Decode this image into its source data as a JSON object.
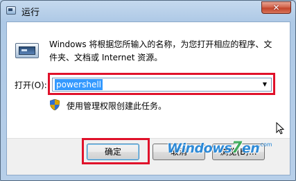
{
  "window": {
    "title": "运行",
    "close_label": "✕"
  },
  "dialog": {
    "description": "Windows 将根据您所输入的名称，为您打开相应的程序、文件夹、文档或 Internet 资源。",
    "open_label": "打开(O):",
    "input_value": "powershell",
    "admin_note": "使用管理权限创建此任务。"
  },
  "buttons": {
    "ok": "确定",
    "cancel": "取消",
    "browse": "浏览(B)..."
  },
  "watermark": {
    "text_a": "Windows",
    "text_seven": "7",
    "text_b": "en",
    "domain": ".com"
  },
  "colors": {
    "highlight": "#e0112a",
    "selection": "#3399ff"
  }
}
